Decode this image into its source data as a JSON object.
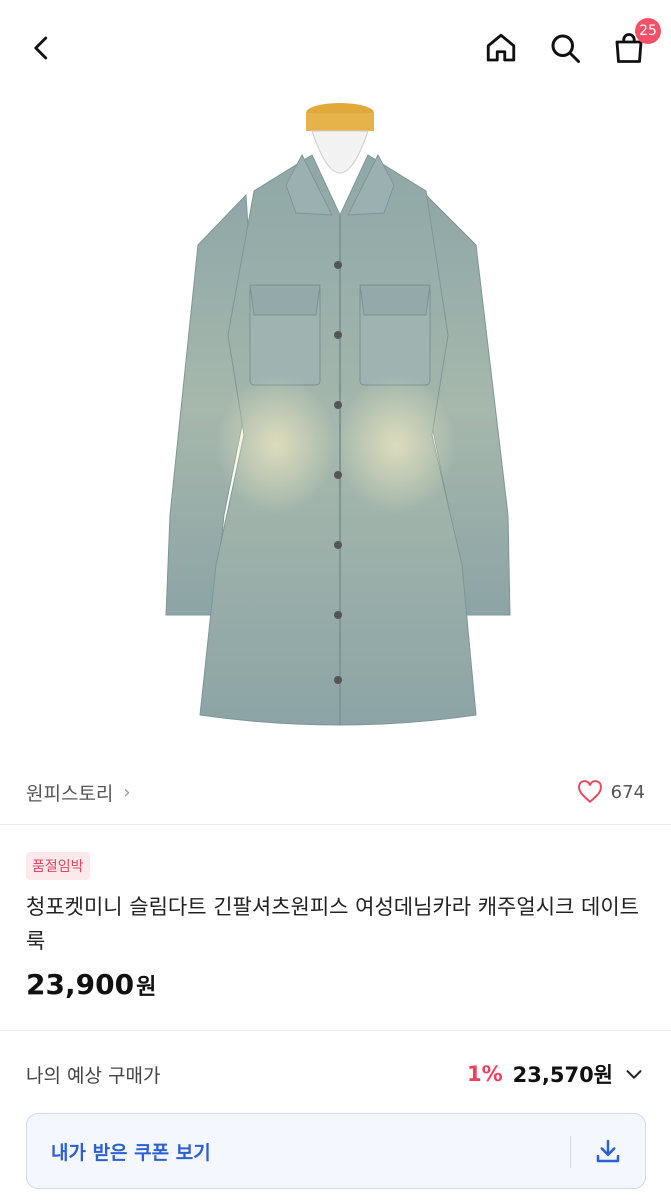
{
  "header": {
    "back_icon": "chevron-left-icon",
    "home_icon": "home-icon",
    "search_icon": "search-icon",
    "cart_icon": "shopping-bag-icon",
    "cart_count": "25"
  },
  "product": {
    "image_alt": "denim shirt dress",
    "store_name": "원피스토리",
    "likes": "674",
    "badge": "품절임박",
    "title": "청포켓미니 슬림다트 긴팔셔츠원피스 여성데님카라 캐주얼시크 데이트룩",
    "price": "23,900",
    "price_unit": "원"
  },
  "purchase": {
    "expected_label": "나의 예상 구매가",
    "discount": "1%",
    "expected_price": "23,570원"
  },
  "coupon": {
    "label": "내가 받은 쿠폰 보기",
    "download_icon": "download-icon"
  },
  "colors": {
    "accent_red": "#f0405c",
    "accent_blue": "#2a5fd6"
  }
}
